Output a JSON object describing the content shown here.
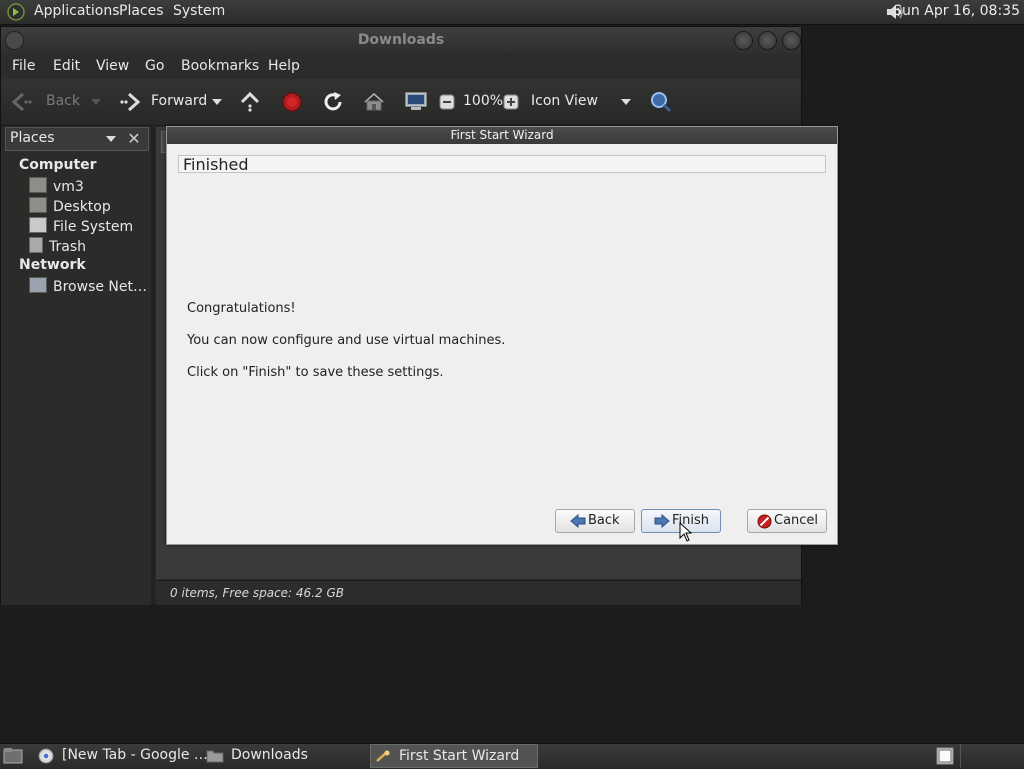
{
  "top_panel": {
    "menus": [
      "Applications",
      "Places",
      "System"
    ],
    "clock": "Sun Apr 16, 08:35",
    "icons": {
      "logo": "gnome-foot-icon",
      "volume": "speaker-icon"
    }
  },
  "file_manager": {
    "title": "Downloads",
    "menubar": [
      "File",
      "Edit",
      "View",
      "Go",
      "Bookmarks",
      "Help"
    ],
    "toolbar": {
      "back_label": "Back",
      "forward_label": "Forward",
      "zoom_level": "100%",
      "view_mode": "Icon View"
    },
    "sidebar": {
      "header": "Places",
      "sections": [
        {
          "title": "Computer",
          "items": [
            "vm3",
            "Desktop",
            "File System",
            "Trash"
          ]
        },
        {
          "title": "Network",
          "items": [
            "Browse Net…"
          ]
        }
      ]
    },
    "status": "0 items, Free space: 46.2 GB"
  },
  "wizard": {
    "title": "First Start Wizard",
    "header": "Finished",
    "lines": [
      "Congratulations!",
      "You can now configure and use virtual machines.",
      "Click on \"Finish\" to save these settings."
    ],
    "buttons": {
      "back": "Back",
      "finish": "Finish",
      "cancel": "Cancel"
    }
  },
  "taskbar": {
    "tasks": [
      "[New Tab - Google …",
      "Downloads",
      "First Start Wizard"
    ],
    "active_task": "First Start Wizard"
  }
}
